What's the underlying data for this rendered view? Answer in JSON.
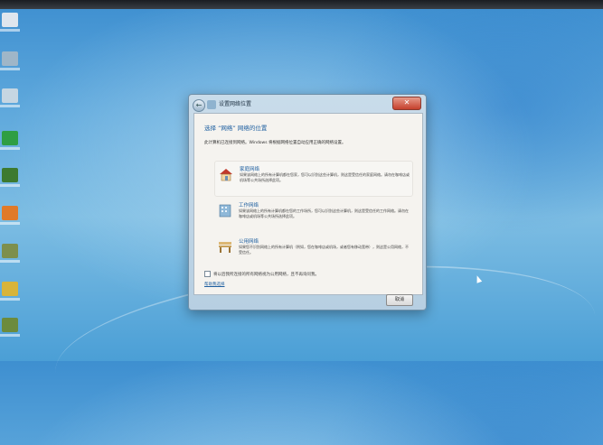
{
  "window": {
    "title": "设置网络位置",
    "close_icon": "close-icon",
    "back_icon": "back-arrow-icon",
    "cancel_label": "取消"
  },
  "dialog": {
    "heading": "选择 “网络” 网络的位置",
    "description": "此计算机已连接到网络。Windows 将根据网络位置自动应用正确的网络设置。",
    "options": [
      {
        "icon": "home-network-icon",
        "title": "家庭网络",
        "description": "如果该网络上的所有计算机都在您家，您可以识别这些计算机，则这是受信任的家庭网络。请勿在咖啡店或机场等公共场所选择此项。"
      },
      {
        "icon": "work-network-icon",
        "title": "工作网络",
        "description": "如果该网络上的所有计算机都在您的工作场所，您可以识别这些计算机，则这是受信任的工作网络。请勿在咖啡店或机场等公共场所选择此项。"
      },
      {
        "icon": "public-network-icon",
        "title": "公用网络",
        "description": "如果您不识别网络上的所有计算机（例如，您在咖啡店或机场，或者您有移动宽带），则这是公用网络，不受信任。"
      }
    ],
    "checkbox_label": "将以后我所连接的所有网络视为公用网络，且不再询问我。",
    "help_link": "帮助我选择"
  }
}
